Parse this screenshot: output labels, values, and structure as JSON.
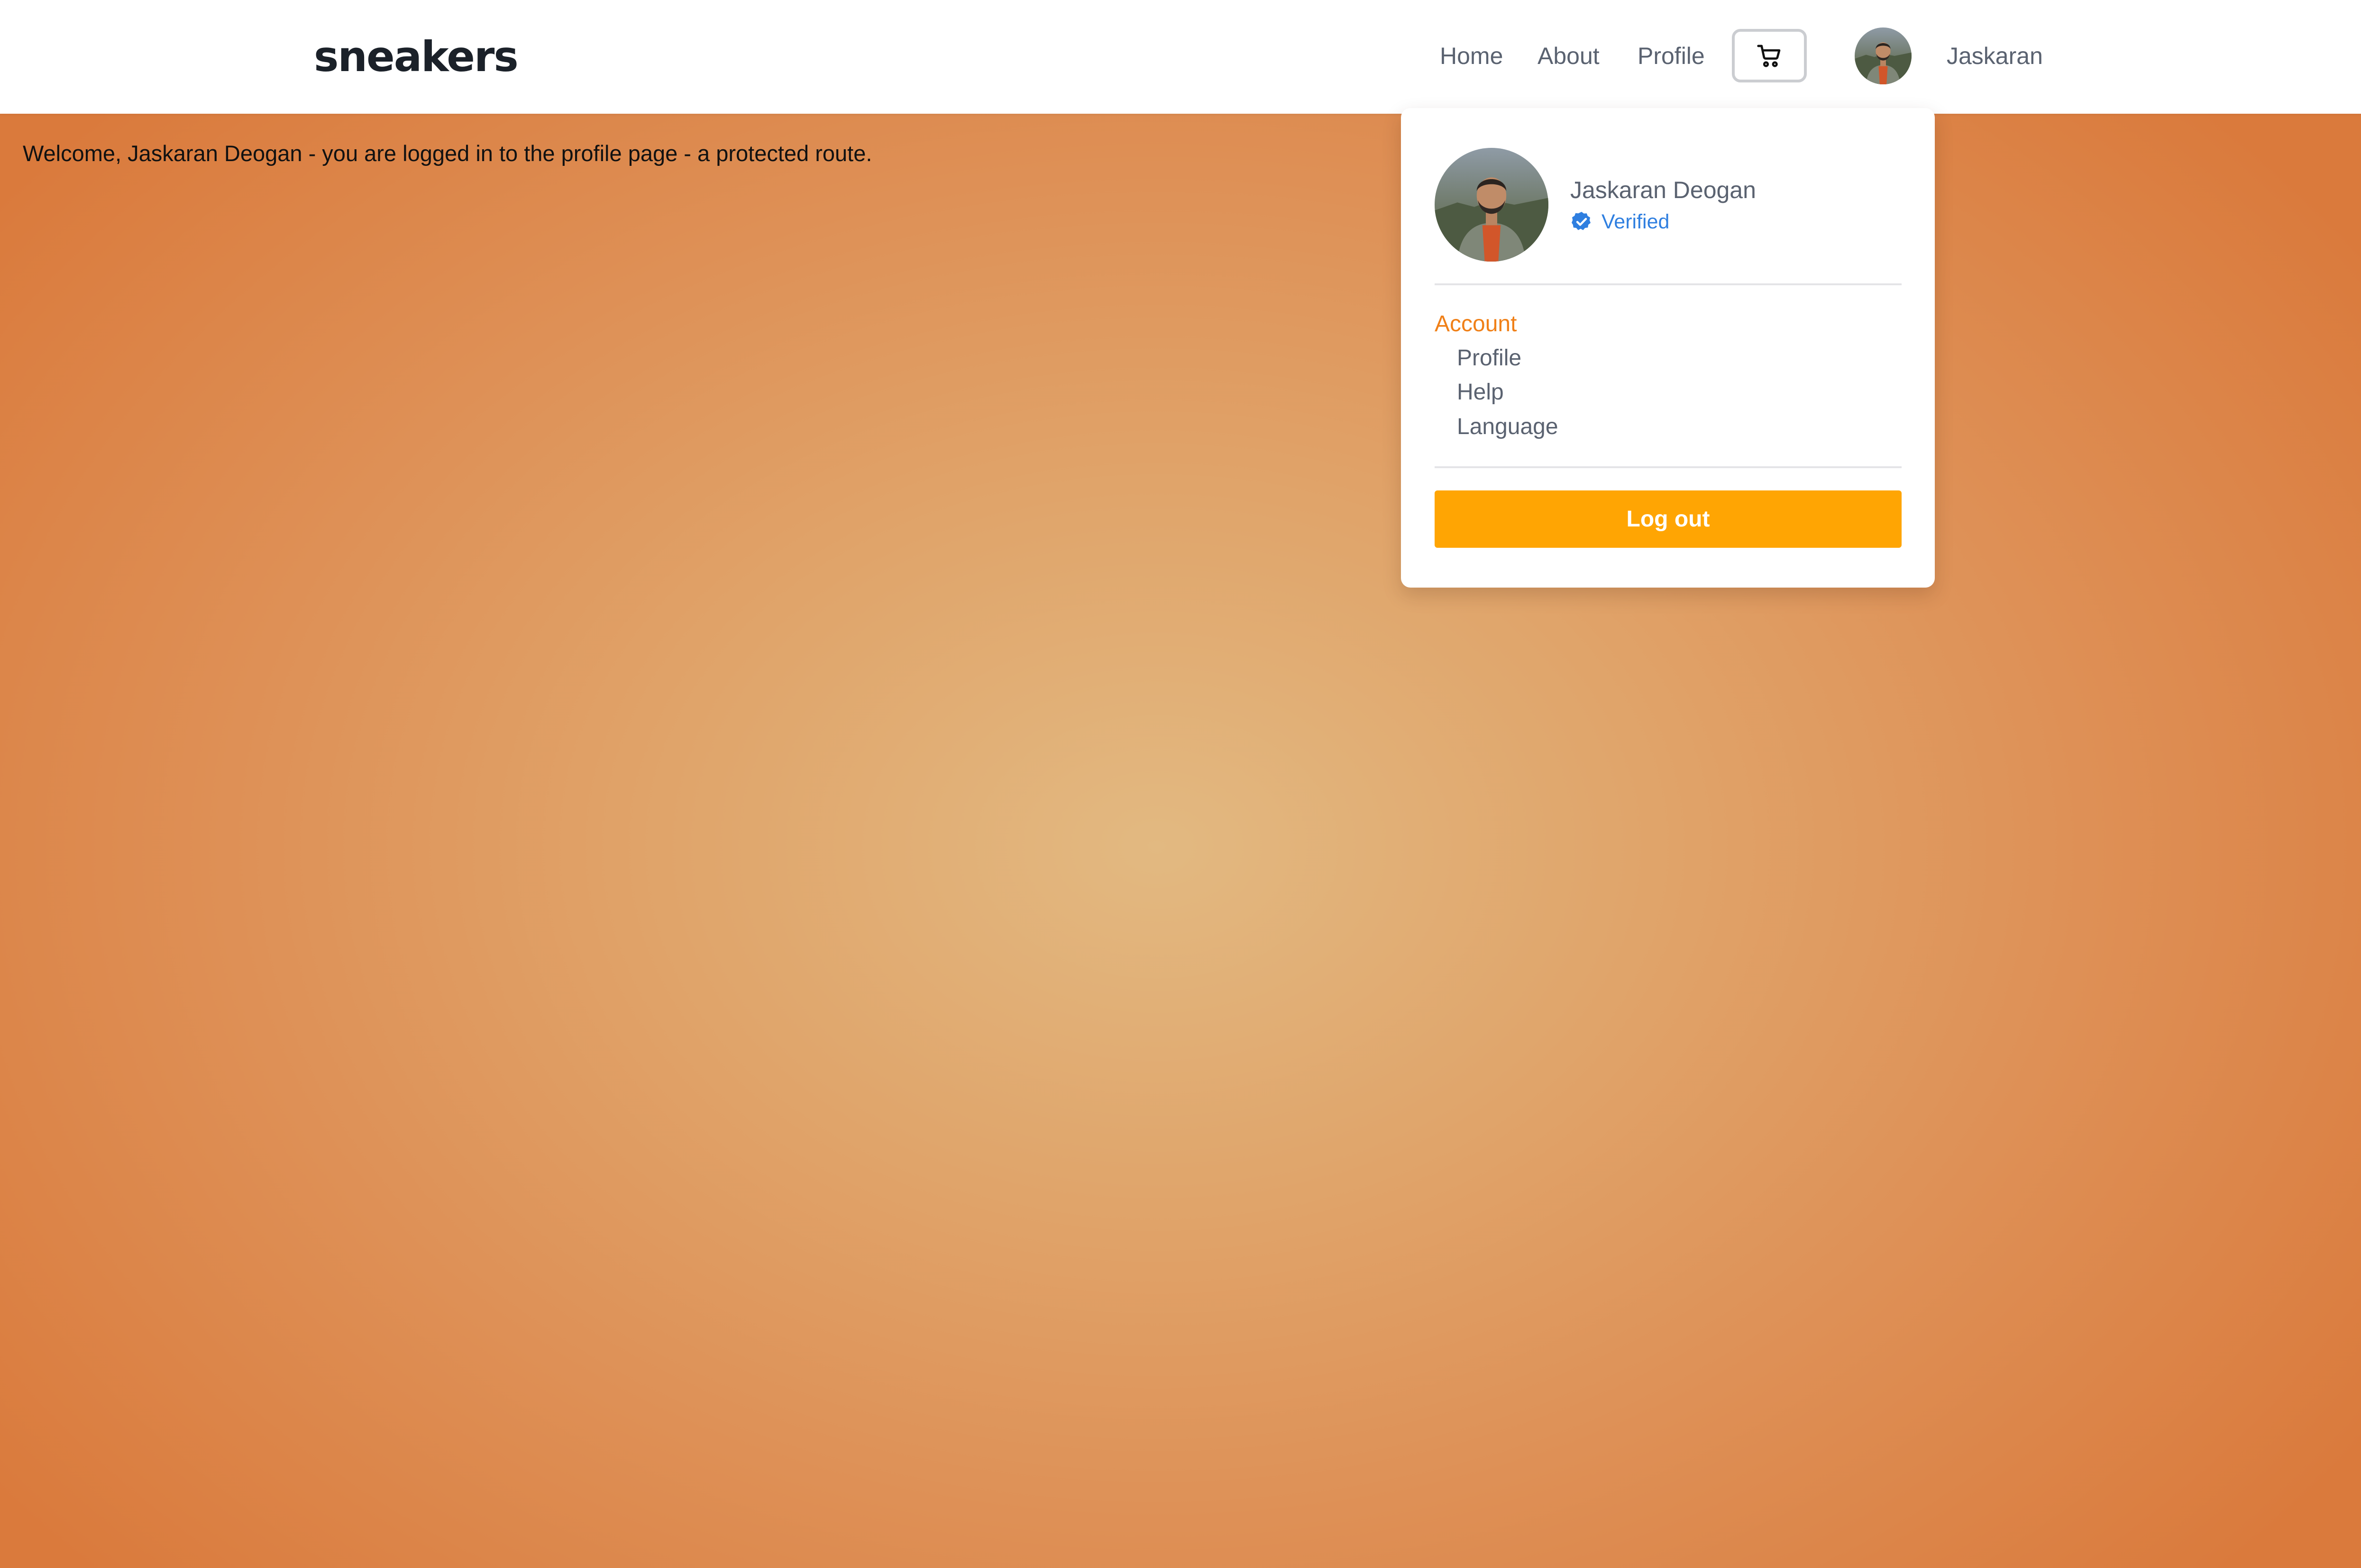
{
  "header": {
    "logo": "sneakers",
    "nav": {
      "home": "Home",
      "about": "About",
      "profile": "Profile"
    },
    "cart_icon": "shopping-cart-icon",
    "avatar_icon": "user-avatar-photo",
    "user_short_name": "Jaskaran"
  },
  "main": {
    "welcome": "Welcome, Jaskaran Deogan - you are logged in to the profile page - a protected route."
  },
  "dropdown": {
    "full_name": "Jaskaran Deogan",
    "verified_label": "Verified",
    "verified_icon": "verified-badge-icon",
    "section_title": "Account",
    "items": [
      "Profile",
      "Help",
      "Language"
    ],
    "logout_label": "Log out"
  },
  "colors": {
    "accent_orange": "#f08018",
    "logout_button": "#ffa503",
    "verified_blue": "#2f7fe0",
    "background_outer": "#da7a3c",
    "background_center": "#e2b981"
  }
}
